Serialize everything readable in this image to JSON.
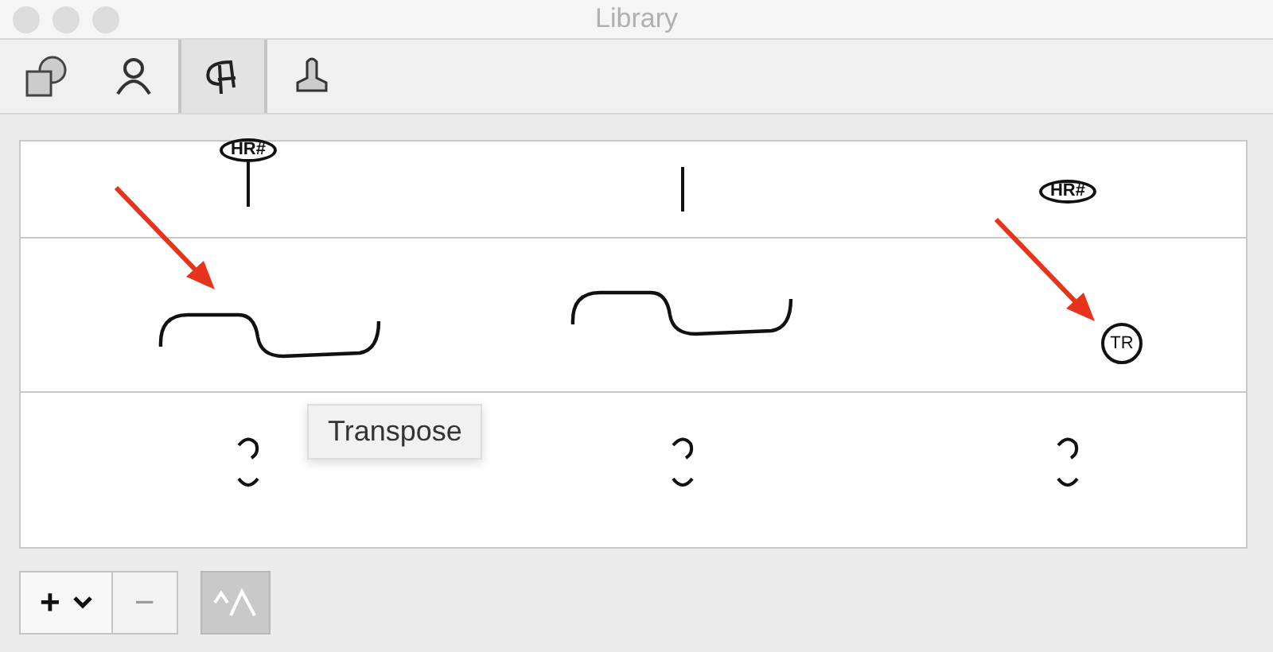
{
  "window": {
    "title": "Library"
  },
  "toolbar": [
    {
      "kind": "shapes",
      "selected": false
    },
    {
      "kind": "person",
      "selected": false
    },
    {
      "kind": "pen",
      "selected": true
    },
    {
      "kind": "stamp",
      "selected": false
    }
  ],
  "grid": {
    "rows": [
      {
        "cells": [
          {
            "kind": "oval_stem",
            "label": "HR#",
            "arrow": false
          },
          {
            "kind": "stem",
            "arrow": false
          },
          {
            "kind": "oval",
            "label": "HR#",
            "arrow": false
          }
        ]
      },
      {
        "cells": [
          {
            "kind": "slur",
            "arrow": true
          },
          {
            "kind": "slur",
            "arrow": false
          },
          {
            "kind": "circle",
            "label": "TR",
            "arrow": true
          }
        ]
      },
      {
        "cells": [
          {
            "kind": "breath",
            "arrow": false
          },
          {
            "kind": "breath",
            "arrow": false
          },
          {
            "kind": "breath",
            "arrow": false
          }
        ]
      }
    ]
  },
  "tooltip": {
    "text": "Transpose"
  },
  "bottom_bar": {
    "add_button": {
      "label": "+"
    },
    "remove_button": {
      "label": "−",
      "disabled": true
    },
    "toggle": {
      "selected": true
    }
  }
}
